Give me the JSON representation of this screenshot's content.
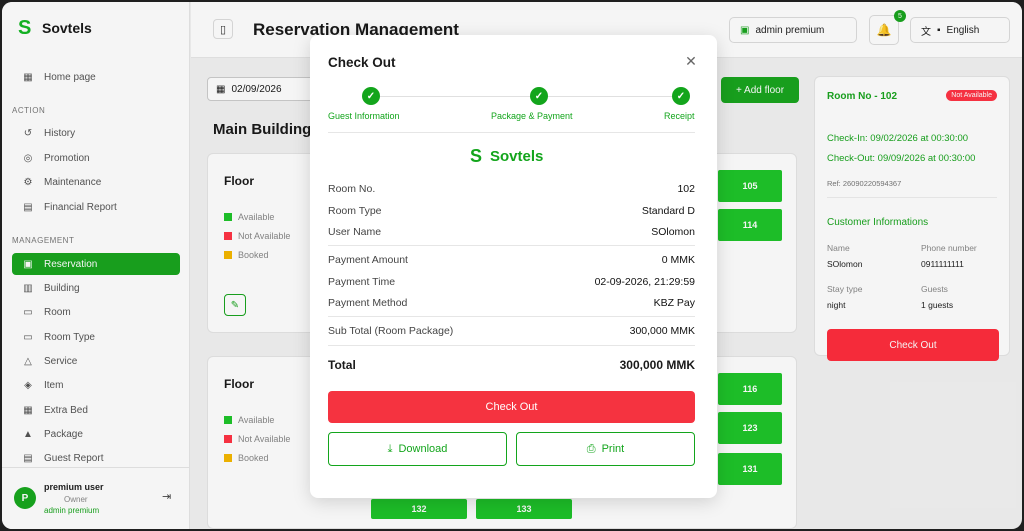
{
  "app": {
    "name": "Sovtels"
  },
  "sidebar": {
    "home": "Home page",
    "action_label": "ACTION",
    "action_items": [
      {
        "label": "History",
        "icon": "history-icon"
      },
      {
        "label": "Promotion",
        "icon": "promotion-icon"
      },
      {
        "label": "Maintenance",
        "icon": "gear-icon"
      },
      {
        "label": "Financial Report",
        "icon": "report-icon"
      }
    ],
    "management_label": "MANAGEMENT",
    "management_items": [
      {
        "label": "Reservation",
        "icon": "reservation-icon",
        "active": true
      },
      {
        "label": "Building",
        "icon": "building-icon"
      },
      {
        "label": "Room",
        "icon": "bed-icon"
      },
      {
        "label": "Room Type",
        "icon": "bed-type-icon"
      },
      {
        "label": "Service",
        "icon": "service-icon"
      },
      {
        "label": "Item",
        "icon": "box-icon"
      },
      {
        "label": "Extra Bed",
        "icon": "grid-icon"
      },
      {
        "label": "Package",
        "icon": "package-icon"
      },
      {
        "label": "Guest Report",
        "icon": "report-icon"
      }
    ],
    "user": {
      "initial": "P",
      "name": "premium user",
      "role": "Owner",
      "plan": "admin premium"
    }
  },
  "header": {
    "title": "Reservation Management",
    "admin": "admin premium",
    "notifications": "5",
    "language": "English"
  },
  "main": {
    "date": "02/09/2026",
    "add_floor": "+ Add floor",
    "building_title": "Main Building",
    "legend": [
      "Available",
      "Not Available",
      "Booked"
    ],
    "floor_label": "Floor",
    "rooms_top": [
      "105",
      "114"
    ],
    "rooms_bottom": [
      "116",
      "123",
      "131"
    ],
    "rooms_footer": [
      "132",
      "133"
    ]
  },
  "room_panel": {
    "title": "Room No - 102",
    "badge": "Not Available",
    "check_in": "Check-In: 09/02/2026 at 00:30:00",
    "check_out": "Check-Out: 09/09/2026 at 00:30:00",
    "ref": "Ref: 26090220594367",
    "section": "Customer Informations",
    "name_k": "Name",
    "name_v": "SOlomon",
    "phone_k": "Phone number",
    "phone_v": "0911111111",
    "stay_k": "Stay type",
    "stay_v": "night",
    "guests_k": "Guests",
    "guests_v": "1 guests",
    "button": "Check Out"
  },
  "modal": {
    "title": "Check Out",
    "steps": [
      "Guest Information",
      "Package & Payment",
      "Receipt"
    ],
    "brand": "Sovtels",
    "rows": [
      {
        "k": "Room No.",
        "v": "102"
      },
      {
        "k": "Room Type",
        "v": "Standard D"
      },
      {
        "k": "User Name",
        "v": "SOlomon"
      },
      {
        "k": "Payment Amount",
        "v": "0 MMK"
      },
      {
        "k": "Payment Time",
        "v": "02-09-2026, 21:29:59"
      },
      {
        "k": "Payment Method",
        "v": "KBZ Pay"
      },
      {
        "k": "Sub Total (Room Package)",
        "v": "300,000 MMK"
      }
    ],
    "total_label": "Total",
    "total_value": "300,000 MMK",
    "checkout": "Check Out",
    "download": "Download",
    "print": "Print"
  },
  "colors": {
    "accent": "#1aa51f",
    "danger": "#f53340"
  }
}
